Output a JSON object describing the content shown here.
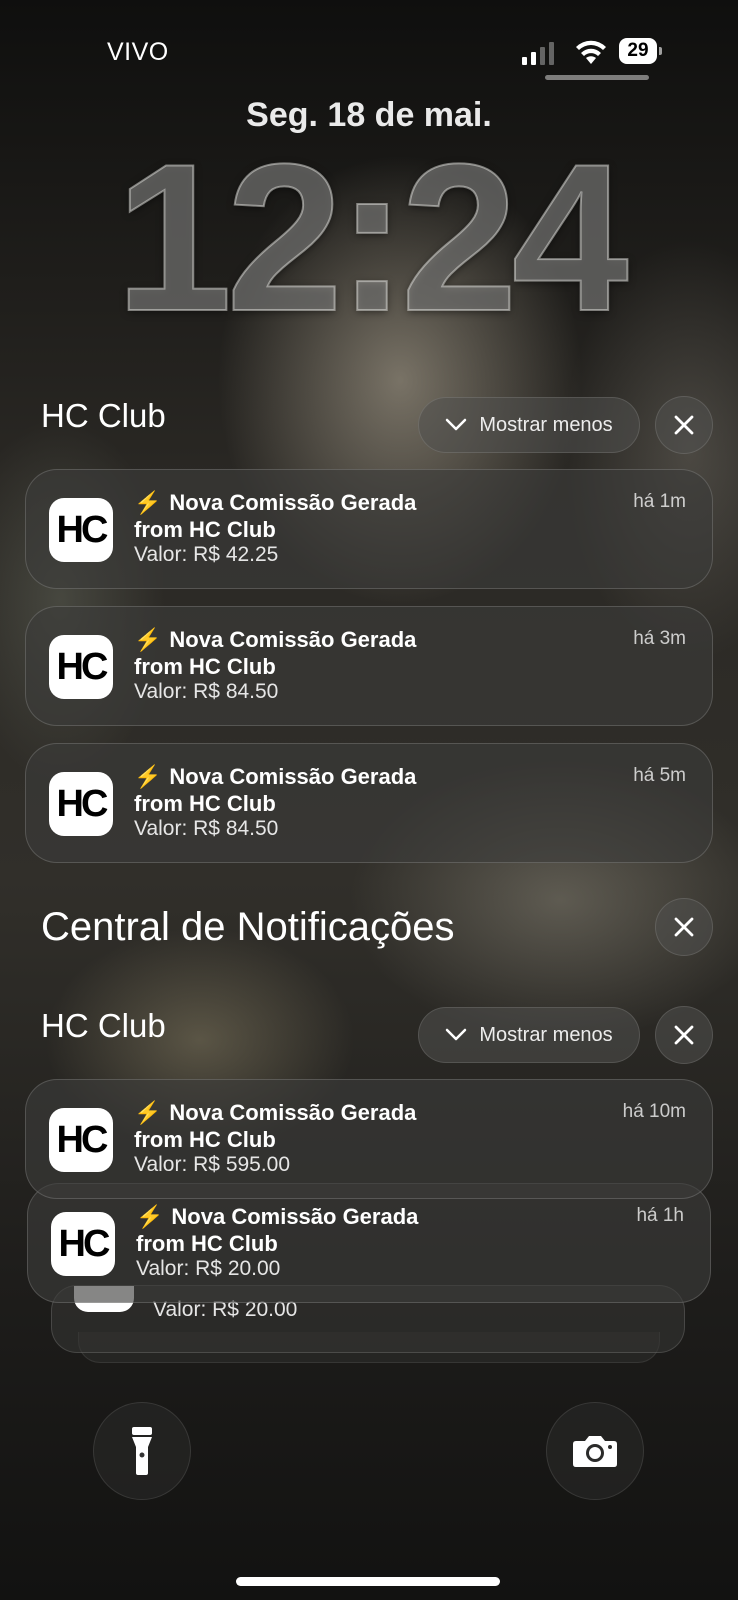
{
  "status_bar": {
    "carrier": "VIVO",
    "battery_level": "29",
    "signal_bars_active": 2,
    "signal_bars_total": 4
  },
  "lock_screen": {
    "date": "Seg. 18 de mai.",
    "time": "12:24"
  },
  "groups": [
    {
      "app_name": "HC Club",
      "collapse_label": "Mostrar menos",
      "notifications": [
        {
          "icon": "hc-club-logo",
          "logo_text": "HC",
          "title": "Nova Comissão Gerada",
          "subtitle": "from HC Club",
          "body": "Valor: R$ 42.25",
          "time": "há 1m"
        },
        {
          "icon": "hc-club-logo",
          "logo_text": "HC",
          "title": "Nova Comissão Gerada",
          "subtitle": "from HC Club",
          "body": "Valor: R$ 84.50",
          "time": "há 3m"
        },
        {
          "icon": "hc-club-logo",
          "logo_text": "HC",
          "title": "Nova Comissão Gerada",
          "subtitle": "from HC Club",
          "body": "Valor: R$ 84.50",
          "time": "há 5m"
        }
      ]
    }
  ],
  "notification_center": {
    "title": "Central de Notificações",
    "groups": [
      {
        "app_name": "HC Club",
        "collapse_label": "Mostrar menos",
        "notifications": [
          {
            "icon": "hc-club-logo",
            "logo_text": "HC",
            "title": "Nova Comissão Gerada",
            "subtitle": "from HC Club",
            "body": "Valor: R$ 595.00",
            "time": "há 10m"
          },
          {
            "icon": "hc-club-logo",
            "logo_text": "HC",
            "title": "Nova Comissão Gerada",
            "subtitle": "from HC Club",
            "body": "Valor: R$ 20.00",
            "time": "há 1h"
          },
          {
            "icon": "hc-club-logo",
            "logo_text": "HC",
            "body": "Valor: R$ 20.00"
          }
        ]
      }
    ]
  },
  "bottom_controls": {
    "left": "flashlight-icon",
    "right": "camera-icon"
  },
  "colors": {
    "bolt": "#f3c23b",
    "card_bg": "rgba(60,60,58,0.62)"
  }
}
